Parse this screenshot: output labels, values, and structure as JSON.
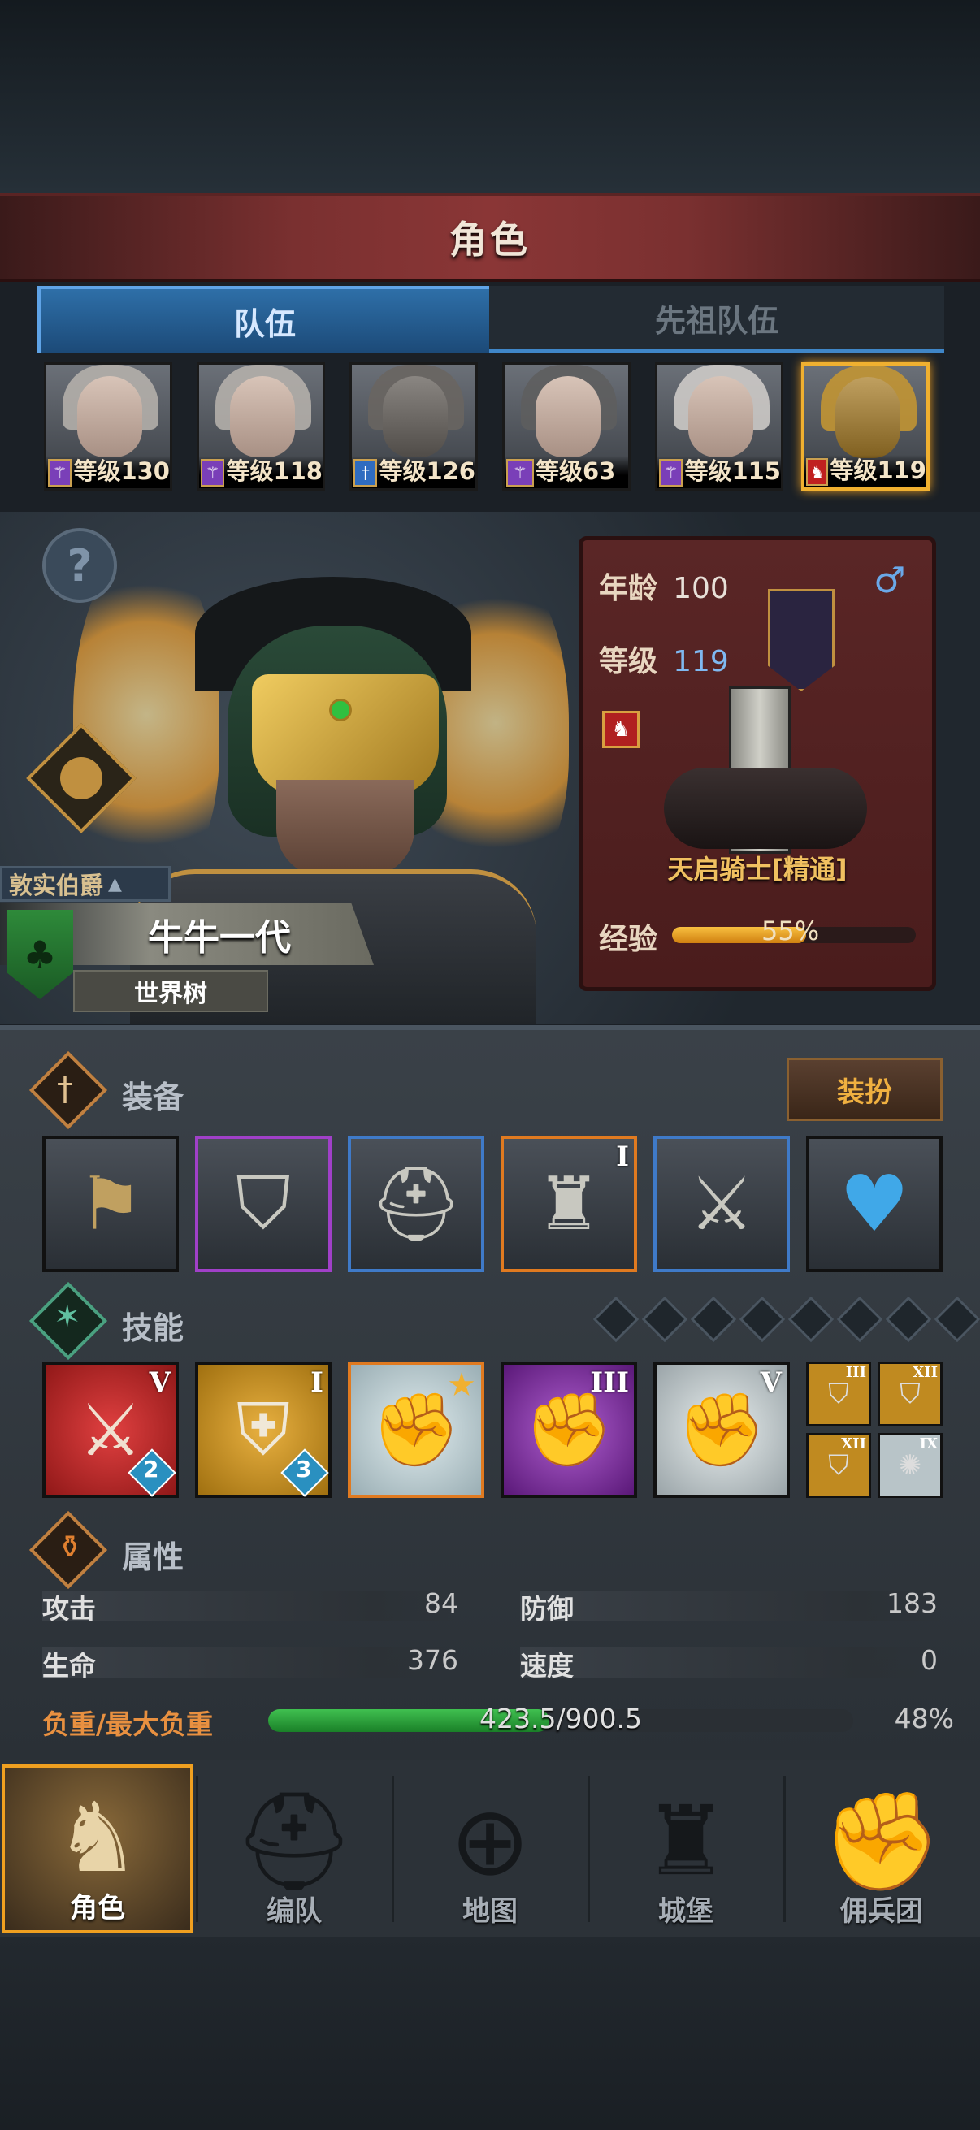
{
  "header": {
    "title": "角色"
  },
  "tabs": [
    {
      "label": "队伍",
      "active": true
    },
    {
      "label": "先祖队伍",
      "active": false
    }
  ],
  "roster": [
    {
      "level_text": "等级130",
      "class_icon": "staff-icon"
    },
    {
      "level_text": "等级118",
      "class_icon": "staff-icon"
    },
    {
      "level_text": "等级126",
      "class_icon": "sword-icon"
    },
    {
      "level_text": "等级63",
      "class_icon": "staff-icon"
    },
    {
      "level_text": "等级115",
      "class_icon": "staff-icon"
    },
    {
      "level_text": "等级119",
      "class_icon": "cavalry-icon",
      "selected": true
    }
  ],
  "hero": {
    "title": "敦实伯爵",
    "name": "牛牛一代",
    "faction": "世界树"
  },
  "info": {
    "age_label": "年龄",
    "age_value": "100",
    "gender_icon": "male-icon",
    "level_label": "等级",
    "level_value": "119",
    "unit_name": "天启骑士[精通]",
    "exp_label": "经验",
    "exp_percent_text": "55%",
    "exp_fraction": 0.55
  },
  "equipment": {
    "section_label": "装备",
    "outfit_button": "装扮",
    "slots": [
      {
        "name": "banner",
        "rarity": "none"
      },
      {
        "name": "shield",
        "rarity": "purple"
      },
      {
        "name": "helmet",
        "rarity": "blue"
      },
      {
        "name": "armor",
        "rarity": "orange",
        "tier": "I"
      },
      {
        "name": "boots",
        "rarity": "blue"
      },
      {
        "name": "amulet",
        "rarity": "none"
      }
    ]
  },
  "skills": {
    "section_label": "技能",
    "items": [
      {
        "tier": "V",
        "badge": "2",
        "color": "#b02020"
      },
      {
        "tier": "I",
        "badge": "3",
        "color": "#c08a20"
      },
      {
        "tier": "",
        "badge": "",
        "color": "#b8c8cc"
      },
      {
        "tier": "III",
        "badge": "",
        "color": "#7a2a9a"
      },
      {
        "tier": "V",
        "badge": "",
        "color": "#b8c0c4"
      }
    ],
    "mini": [
      "III",
      "XII",
      "XII",
      "IX"
    ]
  },
  "attributes": {
    "section_label": "属性",
    "attack_label": "攻击",
    "attack_value": "84",
    "defense_label": "防御",
    "defense_value": "183",
    "hp_label": "生命",
    "hp_value": "376",
    "speed_label": "速度",
    "speed_value": "0",
    "load_label": "负重/最大负重",
    "load_value": "423.5/900.5",
    "load_percent": "48%",
    "load_fraction": 0.48
  },
  "nav": [
    {
      "label": "角色",
      "icon": "knight-icon",
      "active": true
    },
    {
      "label": "编队",
      "icon": "helmet-icon"
    },
    {
      "label": "地图",
      "icon": "compass-icon"
    },
    {
      "label": "城堡",
      "icon": "castle-icon"
    },
    {
      "label": "佣兵团",
      "icon": "mercenary-icon"
    }
  ],
  "colors": {
    "accent": "#f0a020",
    "tab_blue": "#2e6fa8",
    "exp_bar": "#f0a020",
    "load_bar": "#2aa040"
  }
}
